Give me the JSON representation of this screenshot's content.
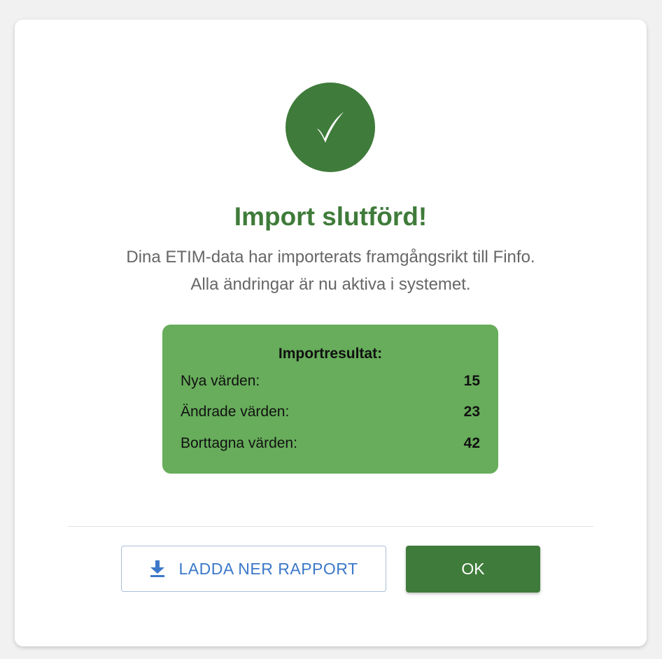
{
  "colors": {
    "success_green": "#3f7b3a",
    "result_box_green": "#67ad5b",
    "link_blue": "#3b78c9"
  },
  "icons": {
    "success": "checkmark-icon",
    "download": "download-icon"
  },
  "dialog": {
    "title": "Import slutförd!",
    "message_lines": [
      "Dina ETIM-data har importerats framgångsrikt till Finfo.",
      "Alla ändringar är nu aktiva i systemet."
    ],
    "results": {
      "title": "Importresultat:",
      "rows": [
        {
          "label": "Nya värden:",
          "value": "15"
        },
        {
          "label": "Ändrade värden:",
          "value": "23"
        },
        {
          "label": "Borttagna värden:",
          "value": "42"
        }
      ]
    },
    "buttons": {
      "download_label": "LADDA NER RAPPORT",
      "ok_label": "OK"
    }
  }
}
